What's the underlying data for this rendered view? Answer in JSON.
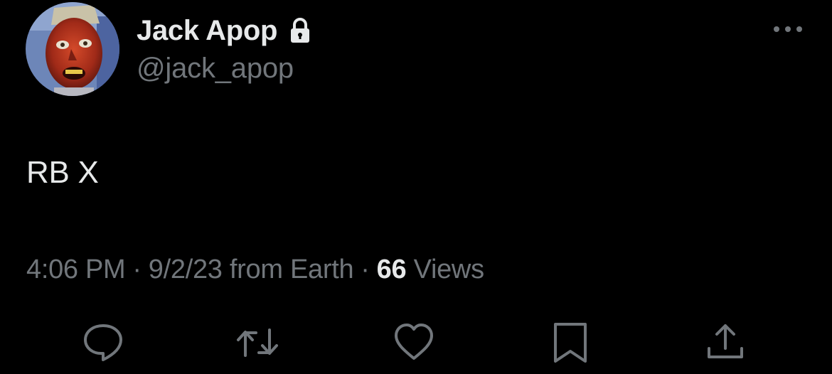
{
  "user": {
    "display_name": "Jack Apop",
    "handle": "@jack_apop"
  },
  "tweet": {
    "text": "RB X"
  },
  "meta": {
    "time": "4:06 PM",
    "separator": "·",
    "date": "9/2/23",
    "source": "from Earth",
    "views_count": "66",
    "views_label": "Views"
  },
  "icons": {
    "lock": "lock-icon",
    "more": "more-horizontal-icon",
    "reply": "reply-icon",
    "retweet": "retweet-icon",
    "like": "heart-icon",
    "bookmark": "bookmark-icon",
    "share": "share-icon"
  },
  "colors": {
    "background": "#000000",
    "primary_text": "#e7e9ea",
    "secondary_text": "#71767b"
  }
}
